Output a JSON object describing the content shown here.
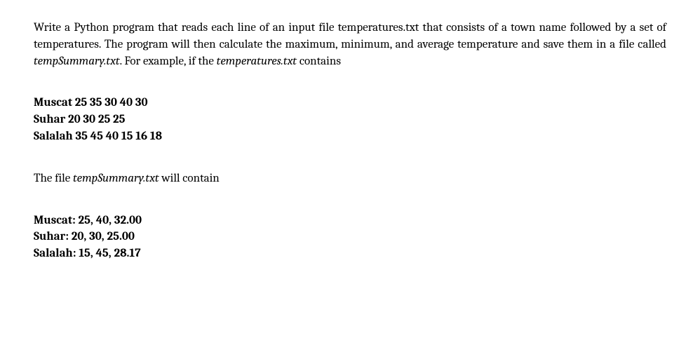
{
  "intro": {
    "prefix": "Write a Python program that reads each line of an input file temperatures.txt that consists of a town name followed by a set of temperatures. The program will then calculate the maximum, minimum, and average temperature and save them in a file called ",
    "italic1": "tempSummary.txt",
    "mid": ". For example, if the ",
    "italic2": "temperatures.txt",
    "suffix": " contains"
  },
  "input_data": {
    "line1": "Muscat 25 35 30 40 30",
    "line2": "Suhar 20 30 25 25",
    "line3": "Salalah 35 45 40 15 16 18"
  },
  "output_label": {
    "prefix": "The file ",
    "italic": "tempSummary.txt",
    "suffix": " will contain"
  },
  "output_data": {
    "line1": "Muscat: 25, 40, 32.00",
    "line2": "Suhar: 20, 30, 25.00",
    "line3": "Salalah: 15, 45, 28.17"
  }
}
